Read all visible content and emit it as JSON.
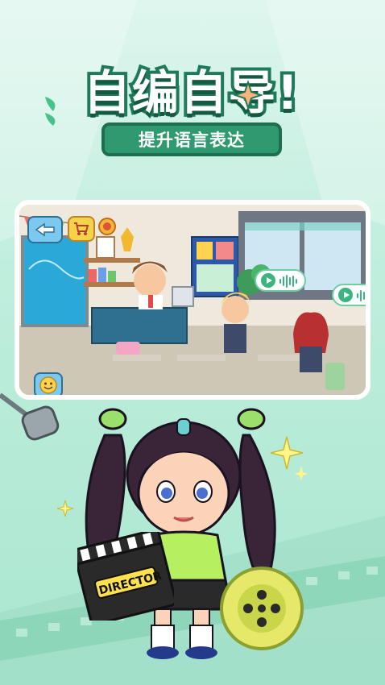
{
  "banner": {
    "title": "自编自导!",
    "subtitle": "提升语言表达"
  },
  "scene": {
    "back_icon": "back-arrow-icon",
    "shop_icon": "shopping-cart-icon",
    "medal_icon": "medal-icon",
    "emoji_icon": "smiley-emoji-icon",
    "voice_icon": "voice-message-icon"
  },
  "clapperboard": {
    "text": "DIRECTOR"
  },
  "colors": {
    "accent": "#2f9a70",
    "title_stroke": "#1f7a5a",
    "background": "#bfeedd"
  }
}
